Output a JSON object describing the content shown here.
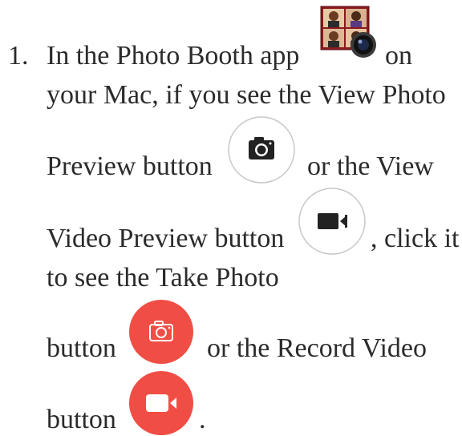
{
  "step": {
    "number": "1.",
    "l1a": "In the Photo Booth app",
    "l1b": "on",
    "l2": "your Mac, if you see the View Photo",
    "l3a": "Preview button",
    "l3b": "or the View",
    "l4a": "Video Preview button",
    "l4b": ", click it",
    "l5": "to see the Take Photo",
    "l6a": "button",
    "l6b": "or the Record Video",
    "l7a": "button",
    "l7b": "."
  },
  "icons": {
    "photo_booth_app": "photo-booth-app-icon",
    "view_photo_preview": "camera-icon",
    "view_video_preview": "video-camera-icon",
    "take_photo": "camera-icon",
    "record_video": "video-camera-icon"
  },
  "colors": {
    "text": "#2b2b2b",
    "record_red": "#f04e45",
    "outline_gray": "#c8c8c8"
  }
}
